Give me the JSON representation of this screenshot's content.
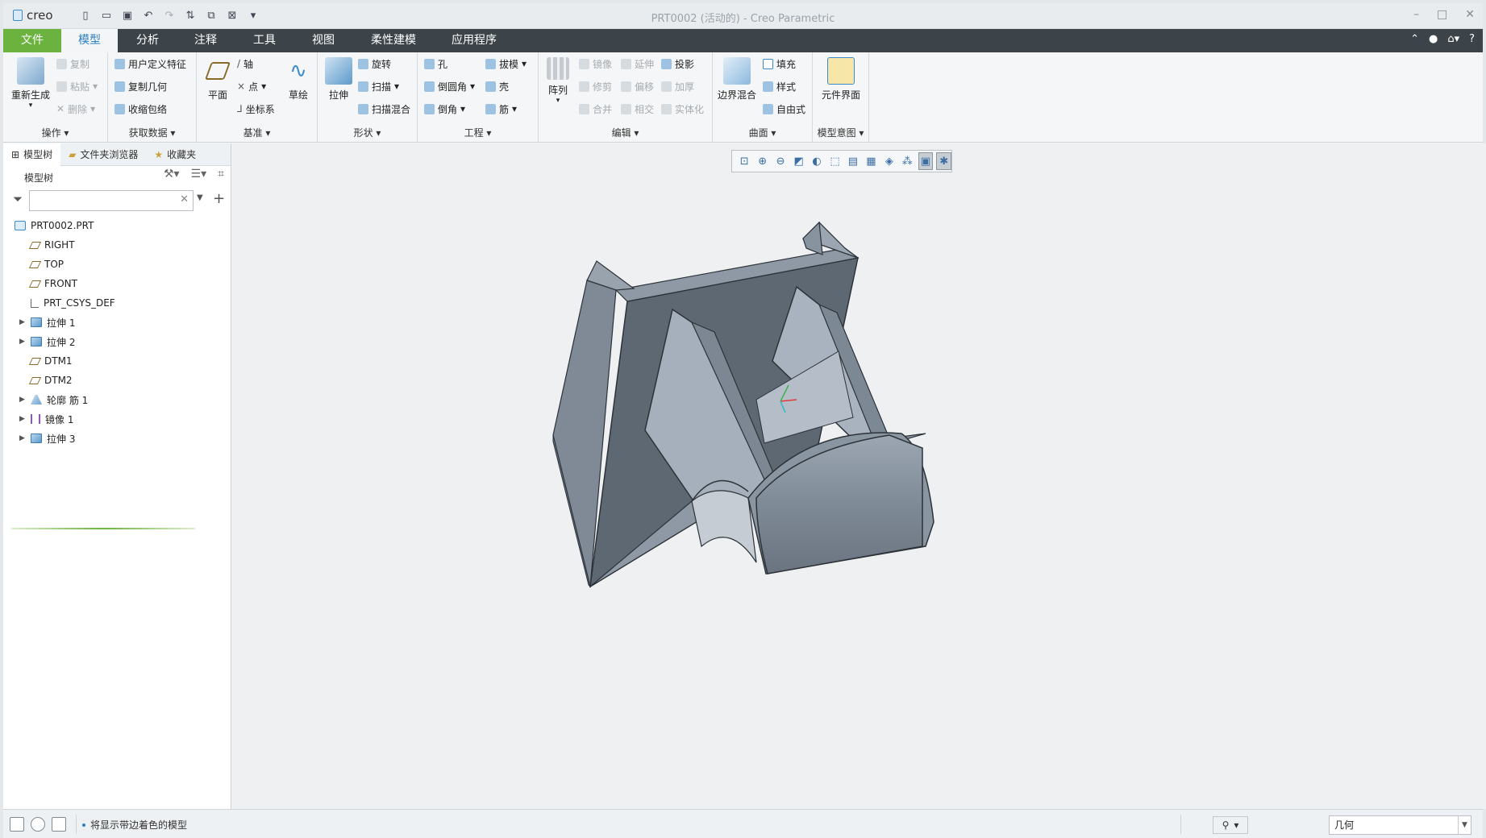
{
  "app": {
    "logo": "creo",
    "window_title": "PRT0002 (活动的) - Creo Parametric"
  },
  "ribbon_tabs": [
    {
      "label": "文件"
    },
    {
      "label": "模型"
    },
    {
      "label": "分析"
    },
    {
      "label": "注释"
    },
    {
      "label": "工具"
    },
    {
      "label": "视图"
    },
    {
      "label": "柔性建模"
    },
    {
      "label": "应用程序"
    }
  ],
  "groups": {
    "operations": {
      "label": "操作",
      "regen": "重新生成",
      "copy": "复制",
      "paste": "粘贴",
      "delete": "删除"
    },
    "get_data": {
      "label": "获取数据",
      "udf": "用户定义特征",
      "copy_geom": "复制几何",
      "shrinkwrap": "收缩包络"
    },
    "datum": {
      "label": "基准",
      "plane": "平面",
      "axis": "轴",
      "point": "点",
      "csys": "坐标系",
      "sketch": "草绘"
    },
    "shapes": {
      "label": "形状",
      "extrude": "拉伸",
      "revolve": "旋转",
      "sweep": "扫描",
      "swept_blend": "扫描混合"
    },
    "engineering": {
      "label": "工程",
      "hole": "孔",
      "round": "倒圆角",
      "chamfer": "倒角",
      "draft": "拔模",
      "shell": "壳",
      "rib": "筋"
    },
    "editing": {
      "label": "编辑",
      "pattern": "阵列",
      "mirror": "镜像",
      "trim": "修剪",
      "merge": "合并",
      "extend": "延伸",
      "offset": "偏移",
      "intersect": "相交",
      "project": "投影",
      "thicken": "加厚",
      "solidify": "实体化"
    },
    "surfaces": {
      "label": "曲面",
      "boundary_blend": "边界混合",
      "fill": "填充",
      "style": "样式",
      "freestyle": "自由式"
    },
    "model_intent": {
      "label": "模型意图",
      "component_interface": "元件界面"
    }
  },
  "panel": {
    "tabs": [
      {
        "label": "模型树"
      },
      {
        "label": "文件夹浏览器"
      },
      {
        "label": "收藏夹"
      }
    ],
    "tree_title": "模型树",
    "search_value": "",
    "nodes": [
      {
        "label": "PRT0002.PRT",
        "icon": "part-icon",
        "expandable": false
      },
      {
        "label": "RIGHT",
        "icon": "datum-plane-icon",
        "expandable": false
      },
      {
        "label": "TOP",
        "icon": "datum-plane-icon",
        "expandable": false
      },
      {
        "label": "FRONT",
        "icon": "datum-plane-icon",
        "expandable": false
      },
      {
        "label": "PRT_CSYS_DEF",
        "icon": "csys-icon",
        "expandable": false
      },
      {
        "label": "拉伸 1",
        "icon": "extrude-icon",
        "expandable": true
      },
      {
        "label": "拉伸 2",
        "icon": "extrude-icon",
        "expandable": true
      },
      {
        "label": "DTM1",
        "icon": "datum-plane-icon",
        "expandable": false
      },
      {
        "label": "DTM2",
        "icon": "datum-plane-icon",
        "expandable": false
      },
      {
        "label": "轮廓 筋 1",
        "icon": "rib-icon",
        "expandable": true
      },
      {
        "label": "镜像 1",
        "icon": "mirror-icon",
        "expandable": true
      },
      {
        "label": "拉伸 3",
        "icon": "extrude-icon",
        "expandable": true
      }
    ]
  },
  "status": {
    "message": "将显示带边着色的模型",
    "filter_value": "几何"
  },
  "colors": {
    "file_tab": "#6bb33e",
    "tab_bar": "#3c4449",
    "active_tab_text": "#2d7fc1",
    "model_light": "#a7b1bd",
    "model_dark": "#5b6570"
  }
}
